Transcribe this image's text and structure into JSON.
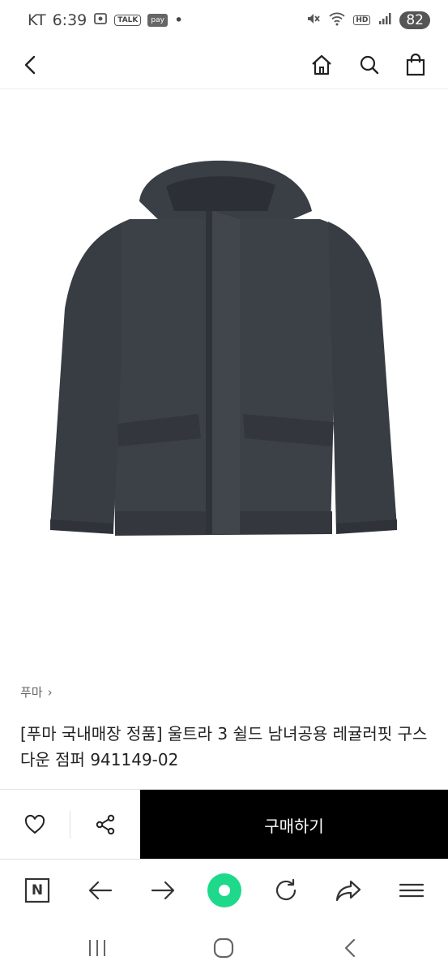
{
  "status_bar": {
    "carrier": "KT",
    "time": "6:39",
    "talk_label": "TALK",
    "pay_label": "pay",
    "dot": "•",
    "hd_label": "HD",
    "battery": "82"
  },
  "top_nav": {
    "icons": [
      "back-icon",
      "home-icon",
      "search-icon",
      "shopping-bag-icon"
    ]
  },
  "product": {
    "image_description_icon": "jacket-image",
    "brand": "푸마",
    "brand_chevron": "›",
    "title": "[푸마 국내매장 정품] 울트라 3 쉴드 남녀공용 레귤러핏 구스다운 점퍼 941149-02"
  },
  "action_bar": {
    "buy_label": "구매하기"
  },
  "browser_bar": {
    "n_label": "N"
  },
  "colors": {
    "buy_bg": "#000000",
    "accent_green": "#1ed98a",
    "jacket": "#3c4047"
  }
}
